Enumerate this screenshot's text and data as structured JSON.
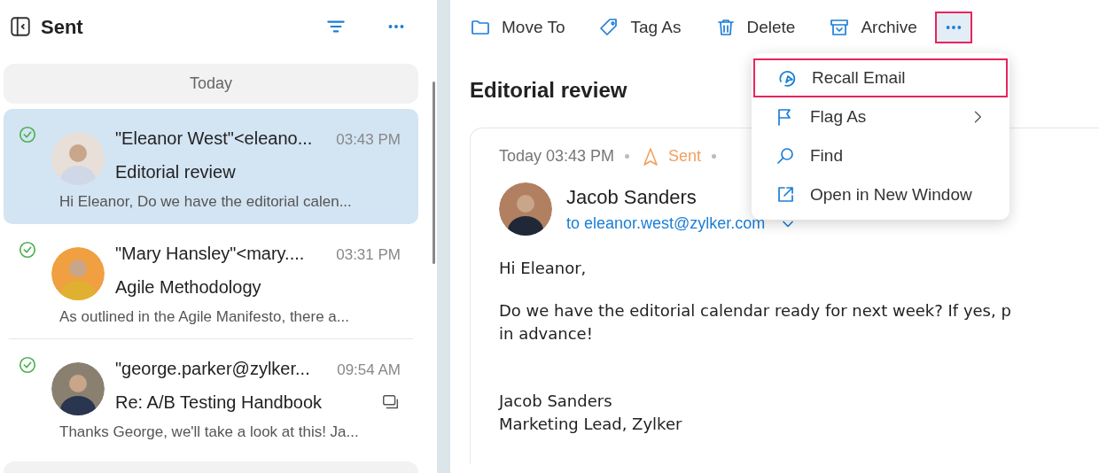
{
  "folder": {
    "title": "Sent"
  },
  "groups": [
    {
      "label": "Today",
      "messages": [
        {
          "sender": "\"Eleanor West\"<eleano...",
          "time": "03:43 PM",
          "subject": "Editorial review",
          "preview": "Hi Eleanor, Do we have the editorial calen...",
          "selected": true,
          "sent": true,
          "thread": false
        },
        {
          "sender": "\"Mary Hansley\"<mary....",
          "time": "03:31 PM",
          "subject": "Agile Methodology",
          "preview": "As outlined in the Agile Manifesto, there a...",
          "selected": false,
          "sent": true,
          "thread": false
        },
        {
          "sender": "\"george.parker@zylker...",
          "time": "09:54 AM",
          "subject": "Re: A/B Testing Handbook",
          "preview": "Thanks George, we'll take a look at this! Ja...",
          "selected": false,
          "sent": true,
          "thread": true
        }
      ]
    }
  ],
  "toolbar": {
    "actions": [
      {
        "kind": "folder",
        "label": "Move To"
      },
      {
        "kind": "tag",
        "label": "Tag As"
      },
      {
        "kind": "trash",
        "label": "Delete"
      },
      {
        "kind": "archive",
        "label": "Archive"
      }
    ],
    "more_highlighted": true
  },
  "menu": {
    "items": [
      {
        "kind": "recall",
        "label": "Recall Email",
        "highlighted": true,
        "submenu": false
      },
      {
        "kind": "flag",
        "label": "Flag As",
        "highlighted": false,
        "submenu": true
      },
      {
        "kind": "find",
        "label": "Find",
        "highlighted": false,
        "submenu": false
      },
      {
        "kind": "open",
        "label": "Open in New Window",
        "highlighted": false,
        "submenu": false
      }
    ]
  },
  "email": {
    "subject": "Editorial review",
    "date": "Today 03:43 PM",
    "status": "Sent",
    "from": "Jacob Sanders",
    "to": "to eleanor.west@zylker.com",
    "body": [
      {
        "lines": [
          "Hi Eleanor,"
        ]
      },
      {
        "lines": [
          "Do we have the editorial calendar ready for next week? If yes, p",
          "in advance!"
        ]
      },
      {
        "lines": [
          "Jacob Sanders",
          "Marketing Lead, Zylker"
        ]
      }
    ]
  }
}
